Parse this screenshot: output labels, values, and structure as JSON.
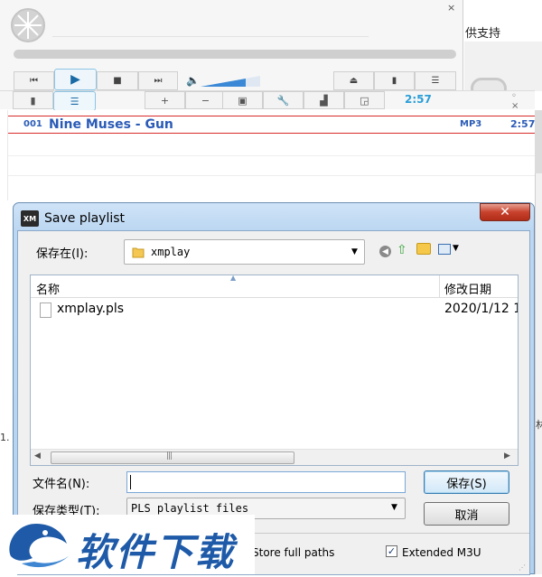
{
  "player": {
    "close_glyph": "×",
    "right_window_text": "供支持"
  },
  "playlist": {
    "time": "2:57",
    "window_buttons": "◦ ×",
    "track": {
      "number": "001",
      "title": "Nine Muses - Gun",
      "format": "MP3",
      "duration": "2:57"
    },
    "left_edge_text": "1.",
    "right_edge_text": "林"
  },
  "dialog": {
    "icon_text": "XM",
    "title": "Save playlist",
    "close_glyph": "✕",
    "save_in_label": "保存在(I):",
    "save_in_value": "xmplay",
    "columns": {
      "name": "名称",
      "date": "修改日期"
    },
    "files": [
      {
        "name": "xmplay.pls",
        "date": "2020/1/12 1"
      }
    ],
    "filename_label": "文件名(N):",
    "filename_value": "",
    "filetype_label": "保存类型(T):",
    "filetype_value": "PLS playlist files",
    "save_label": "保存(S)",
    "cancel_label": "取消",
    "store_paths_label": "Store full paths",
    "extended_m3u_label": "Extended M3U",
    "extended_m3u_checked": true
  },
  "watermark": {
    "text": "软件下载"
  },
  "colors": {
    "accent": "#2a5bb7",
    "playing_line": "#d92a2a",
    "time": "#2a9ed8",
    "close_button": "#c7412c"
  }
}
